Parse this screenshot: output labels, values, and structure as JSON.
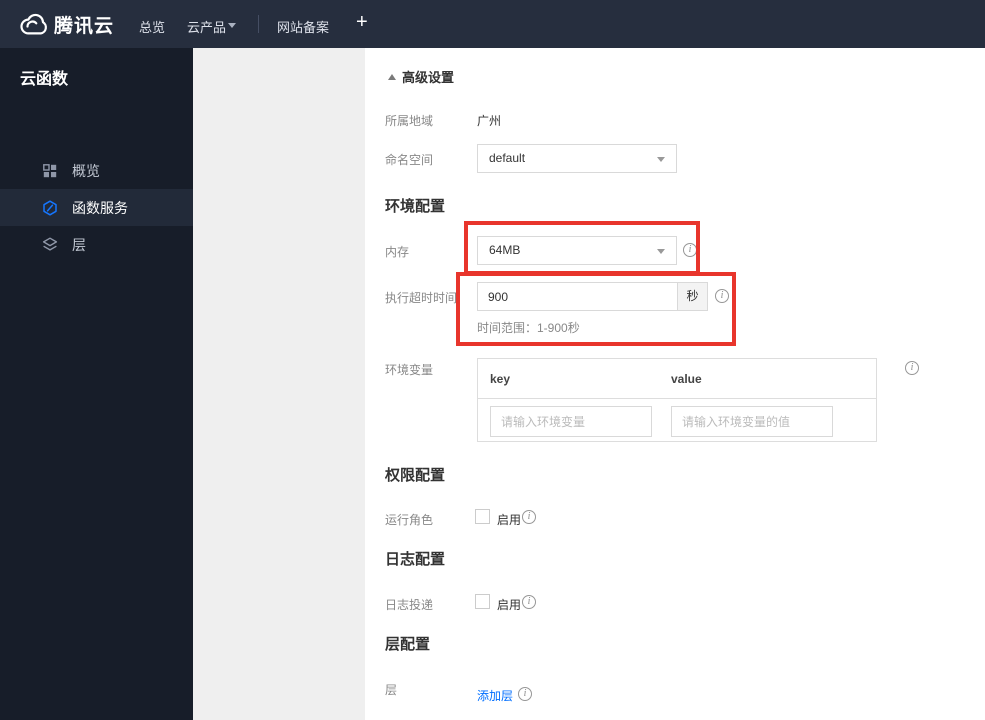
{
  "colors": {
    "navbar_bg": "#262e3e",
    "sidebar_bg": "#171d29",
    "sidebar_active_bg": "#222a39",
    "panel_bg": "#efefef",
    "accent_blue": "#006eff",
    "annotation_red": "#e8352c"
  },
  "icons": {
    "logo": "cloud-icon",
    "overview": "grid-icon",
    "functions": "scf-hexagon-icon",
    "layers": "layers-icon",
    "dropdown": "chevron-down-icon",
    "info": "info-circle-icon",
    "advanced": "triangle-up-icon"
  },
  "navbar": {
    "logo_text": "腾讯云",
    "items": [
      {
        "label": "总览"
      },
      {
        "label": "云产品"
      },
      {
        "label": "网站备案"
      }
    ],
    "plus_label": "+"
  },
  "sidebar": {
    "title": "云函数",
    "items": [
      {
        "label": "概览",
        "active": false
      },
      {
        "label": "函数服务",
        "active": true
      },
      {
        "label": "层",
        "active": false
      }
    ]
  },
  "main": {
    "advanced_toggle": {
      "label": "高级设置",
      "state": "expanded"
    },
    "region": {
      "label": "所属地域",
      "value": "广州"
    },
    "namespace": {
      "label": "命名空间",
      "value": "default"
    },
    "sections": {
      "env": "环境配置",
      "perm": "权限配置",
      "log": "日志配置",
      "layer": "层配置"
    },
    "memory": {
      "label": "内存",
      "value": "64MB"
    },
    "timeout": {
      "label": "执行超时时间",
      "value": "900",
      "unit": "秒",
      "hint": "时间范围：1-900秒"
    },
    "env_vars": {
      "label": "环境变量",
      "columns": [
        "key",
        "value"
      ],
      "key_placeholder": "请输入环境变量",
      "value_placeholder": "请输入环境变量的值"
    },
    "role": {
      "label": "运行角色",
      "checkbox_label": "启用",
      "checked": false
    },
    "log_delivery": {
      "label": "日志投递",
      "checkbox_label": "启用",
      "checked": false
    },
    "layer": {
      "label": "层",
      "link_label": "添加层"
    }
  }
}
